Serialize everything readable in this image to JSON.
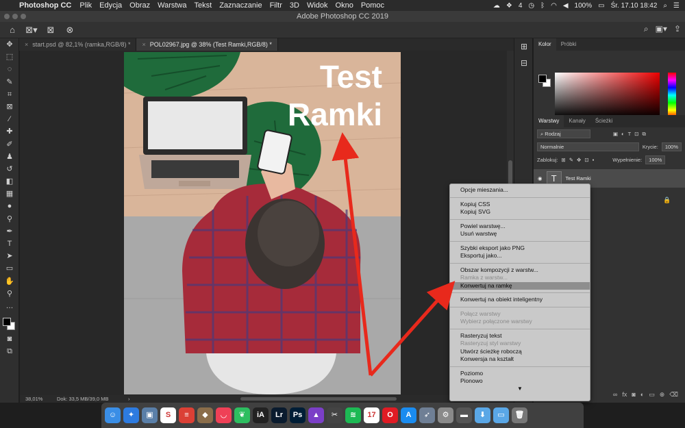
{
  "menubar": {
    "app_name": "Photoshop CC",
    "items": [
      "Plik",
      "Edycja",
      "Obraz",
      "Warstwa",
      "Tekst",
      "Zaznaczanie",
      "Filtr",
      "3D",
      "Widok",
      "Okno",
      "Pomoc"
    ],
    "status": {
      "num": "4",
      "battery": "100%",
      "datetime": "Śr. 17.10  18:42"
    }
  },
  "window": {
    "title": "Adobe Photoshop CC 2019"
  },
  "doc_tabs": [
    {
      "label": "start.psd @ 82,1% (ramka,RGB/8) *"
    },
    {
      "label": "POL02967.jpg @ 38% (Test Ramki,RGB/8) *"
    }
  ],
  "canvas": {
    "text_line1": "Test",
    "text_line2": "Ramki"
  },
  "statusbar": {
    "zoom": "38,01%",
    "doc": "Dok: 33,5 MB/39,0 MB"
  },
  "color_panel": {
    "tabs": [
      "Kolor",
      "Próbki"
    ]
  },
  "layers_panel": {
    "tabs": [
      "Warstwy",
      "Kanały",
      "Ścieżki"
    ],
    "filter": "Rodzaj",
    "blend_mode": "Normalnie",
    "opacity_label": "Krycie:",
    "opacity": "100%",
    "lock_label": "Zablokuj:",
    "fill_label": "Wypełnienie:",
    "fill": "100%",
    "layer_name": "Test Ramki",
    "footer_fx": "fx"
  },
  "context_menu": {
    "items": [
      {
        "label": "Opcje mieszania...",
        "state": "enabled"
      },
      {
        "sep": true
      },
      {
        "label": "Kopiuj CSS",
        "state": "enabled"
      },
      {
        "label": "Kopiuj SVG",
        "state": "enabled"
      },
      {
        "sep": true
      },
      {
        "label": "Powiel warstwę...",
        "state": "enabled"
      },
      {
        "label": "Usuń warstwę",
        "state": "enabled"
      },
      {
        "sep": true
      },
      {
        "label": "Szybki eksport jako PNG",
        "state": "enabled"
      },
      {
        "label": "Eksportuj jako...",
        "state": "enabled"
      },
      {
        "sep": true
      },
      {
        "label": "Obszar kompozycji z warstw...",
        "state": "enabled"
      },
      {
        "label": "Ramka z warstw...",
        "state": "disabled"
      },
      {
        "label": "Konwertuj na ramkę",
        "state": "highlighted"
      },
      {
        "sep": true
      },
      {
        "label": "Konwertuj na obiekt inteligentny",
        "state": "enabled"
      },
      {
        "sep": true
      },
      {
        "label": "Połącz warstwy",
        "state": "disabled"
      },
      {
        "label": "Wybierz połączone warstwy",
        "state": "disabled"
      },
      {
        "sep": true
      },
      {
        "label": "Rasteryzuj tekst",
        "state": "enabled"
      },
      {
        "label": "Rasteryzuj styl warstwy",
        "state": "disabled"
      },
      {
        "label": "Utwórz ścieżkę roboczą",
        "state": "enabled"
      },
      {
        "label": "Konwersja na kształt",
        "state": "enabled"
      },
      {
        "sep": true
      },
      {
        "label": "Poziomo",
        "state": "enabled"
      },
      {
        "label": "Pionowo",
        "state": "enabled"
      }
    ],
    "more_indicator": "▼"
  },
  "dock": {
    "apps": [
      {
        "name": "finder",
        "glyph": "☺",
        "color": "#3a8ee6"
      },
      {
        "name": "safari",
        "glyph": "✦",
        "color": "#2d7be0"
      },
      {
        "name": "preview",
        "glyph": "▣",
        "color": "#5a7fa8"
      },
      {
        "name": "slack",
        "glyph": "S",
        "color": "#ffffff"
      },
      {
        "name": "todoist",
        "glyph": "≡",
        "color": "#db4035"
      },
      {
        "name": "security",
        "glyph": "◆",
        "color": "#8a6d4a"
      },
      {
        "name": "pocket",
        "glyph": "◡",
        "color": "#ef4056"
      },
      {
        "name": "evernote",
        "glyph": "❦",
        "color": "#2dbe60"
      },
      {
        "name": "ia-writer",
        "glyph": "iA",
        "color": "#222222"
      },
      {
        "name": "lightroom",
        "glyph": "Lr",
        "color": "#0a1b2e"
      },
      {
        "name": "photoshop",
        "glyph": "Ps",
        "color": "#001e36"
      },
      {
        "name": "affinity",
        "glyph": "▲",
        "color": "#7b3fc7"
      },
      {
        "name": "final-cut",
        "glyph": "✂",
        "color": "#444444"
      },
      {
        "name": "spotify",
        "glyph": "≋",
        "color": "#1db954"
      },
      {
        "name": "calendar",
        "glyph": "17",
        "color": "#ffffff"
      },
      {
        "name": "opera",
        "glyph": "O",
        "color": "#e01b24"
      },
      {
        "name": "app-store",
        "glyph": "A",
        "color": "#1a8cf0"
      },
      {
        "name": "launchpad",
        "glyph": "➶",
        "color": "#6f7f95"
      },
      {
        "name": "system-prefs",
        "glyph": "⚙",
        "color": "#8a8a8a"
      },
      {
        "name": "disk",
        "glyph": "▬",
        "color": "#555555"
      },
      {
        "name": "downloads",
        "glyph": "⬇",
        "color": "#5aa7e6"
      },
      {
        "name": "folder",
        "glyph": "▭",
        "color": "#5aa7e6"
      },
      {
        "name": "trash",
        "glyph": "🗑",
        "color": "#777777"
      }
    ]
  }
}
